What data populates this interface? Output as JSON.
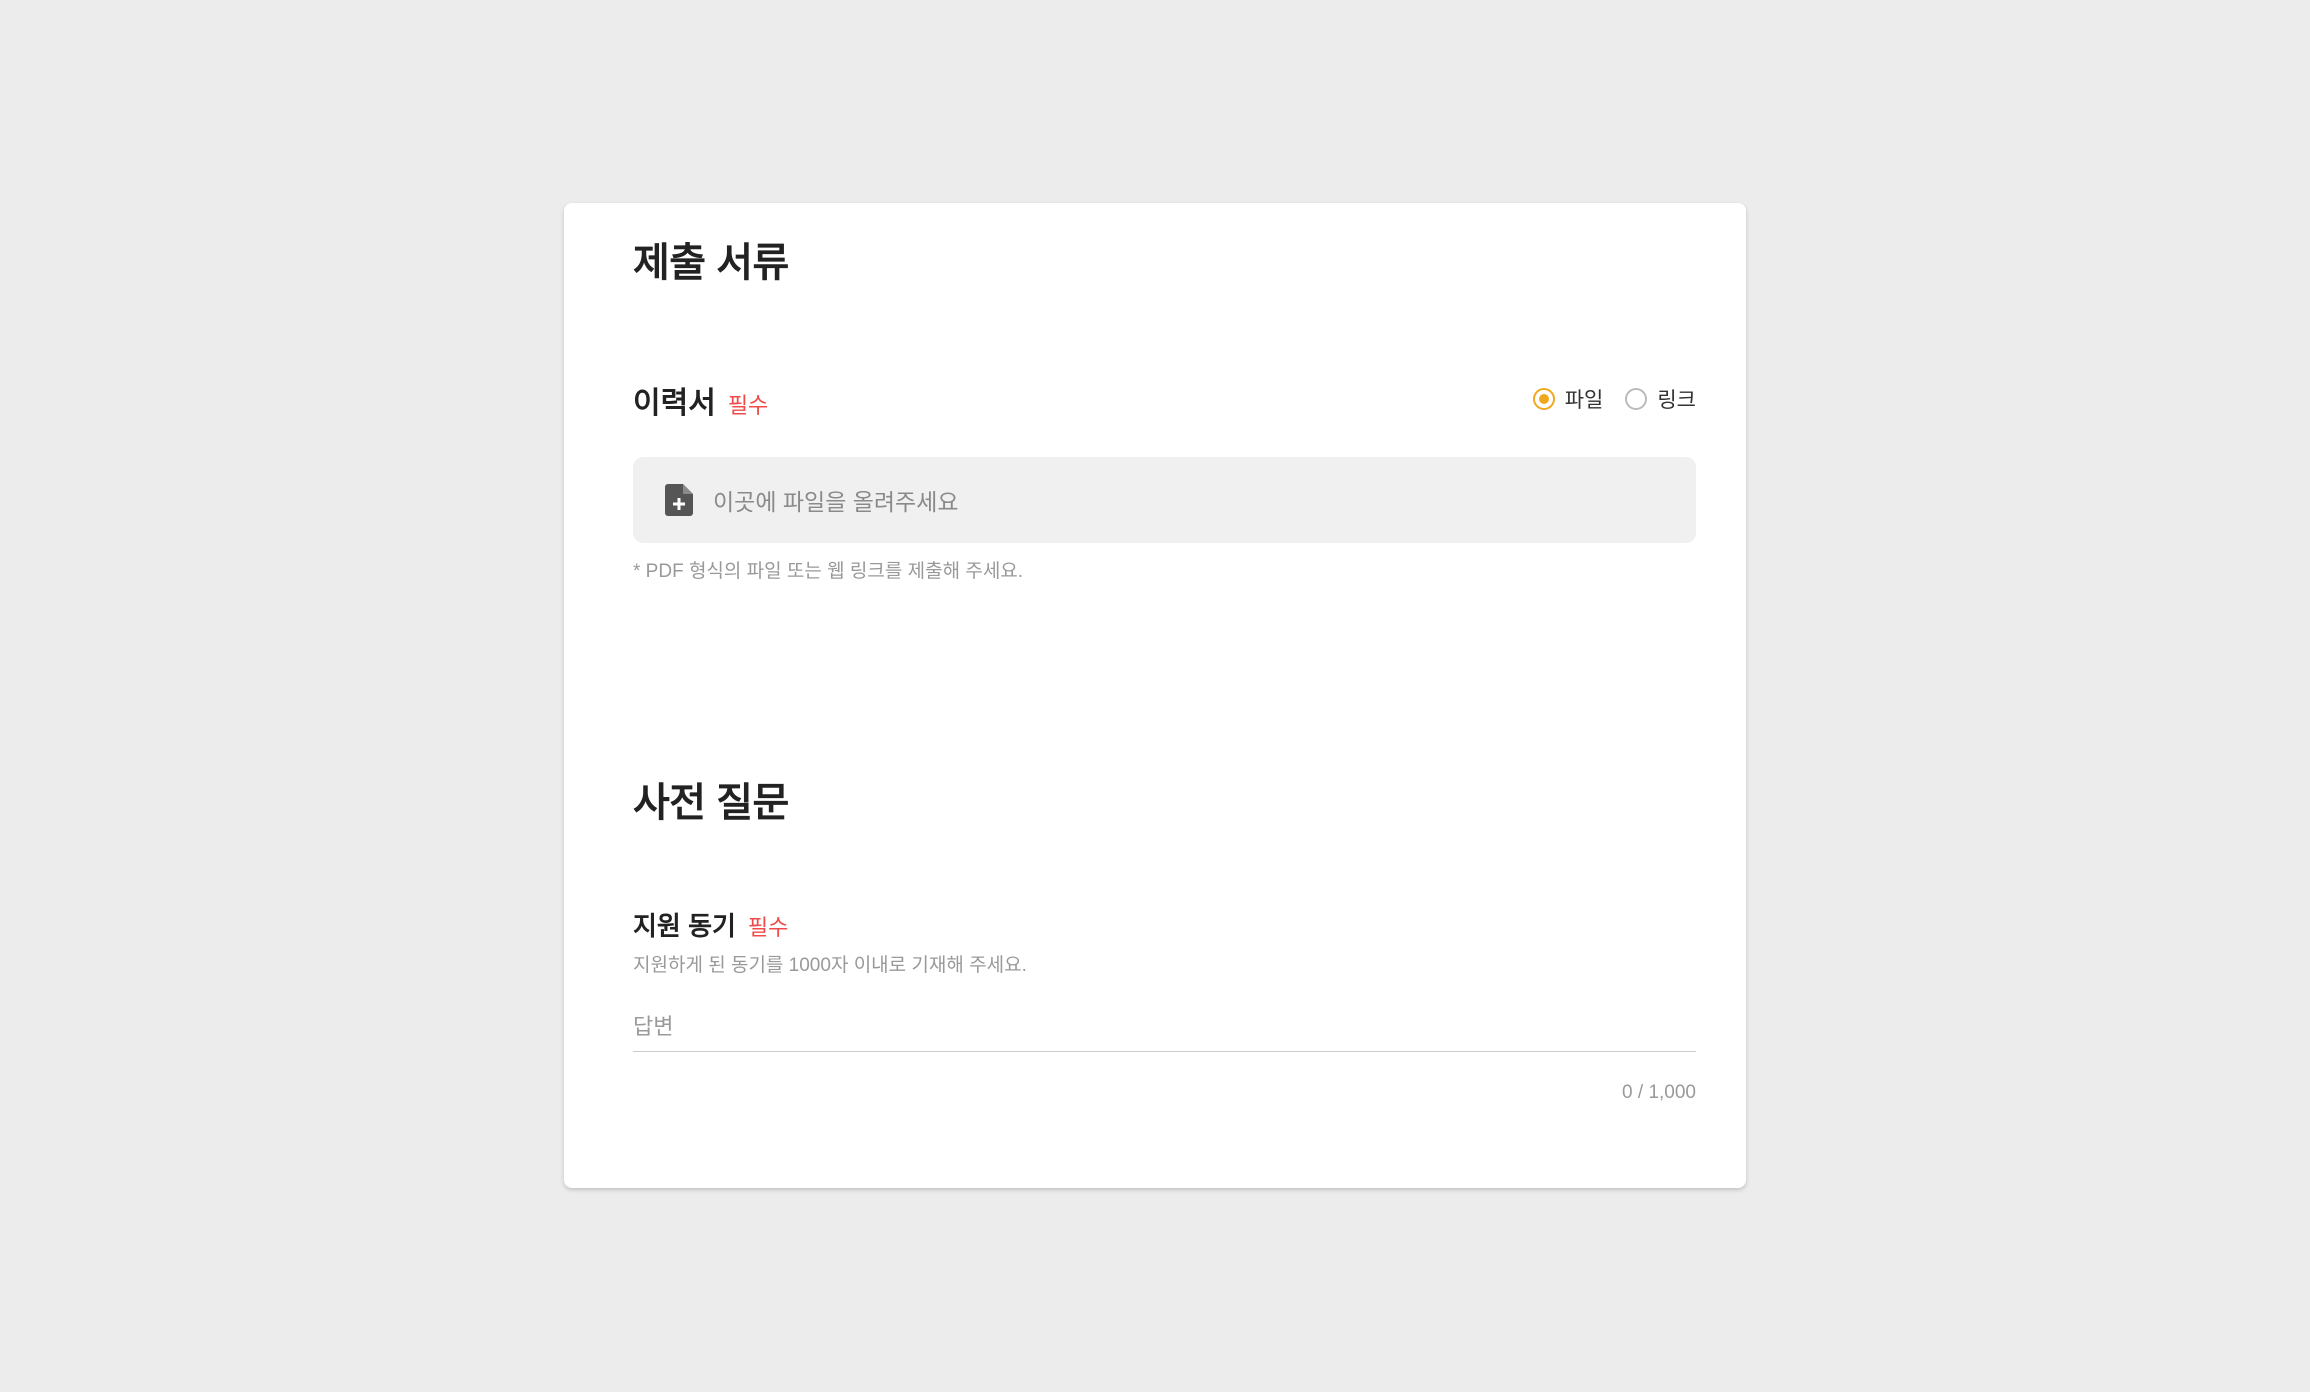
{
  "sections": {
    "documents": {
      "title": "제출 서류",
      "resume": {
        "label": "이력서",
        "required": "필수",
        "options": {
          "file": "파일",
          "link": "링크",
          "selected": "file"
        },
        "upload_placeholder": "이곳에 파일을 올려주세요",
        "hint": "* PDF 형식의 파일 또는 웹 링크를 제출해 주세요."
      }
    },
    "questions": {
      "title": "사전 질문",
      "motive": {
        "label": "지원 동기",
        "required": "필수",
        "description": "지원하게 된 동기를 1000자 이내로 기재해 주세요.",
        "answer_placeholder": "답변",
        "answer_value": "",
        "counter": "0 / 1,000"
      }
    }
  },
  "colors": {
    "background": "#ececec",
    "card": "#ffffff",
    "accent": "#f0a91e",
    "required": "#f04b4b",
    "muted_text": "#999999"
  },
  "icons": {
    "upload": "file-plus-icon"
  }
}
